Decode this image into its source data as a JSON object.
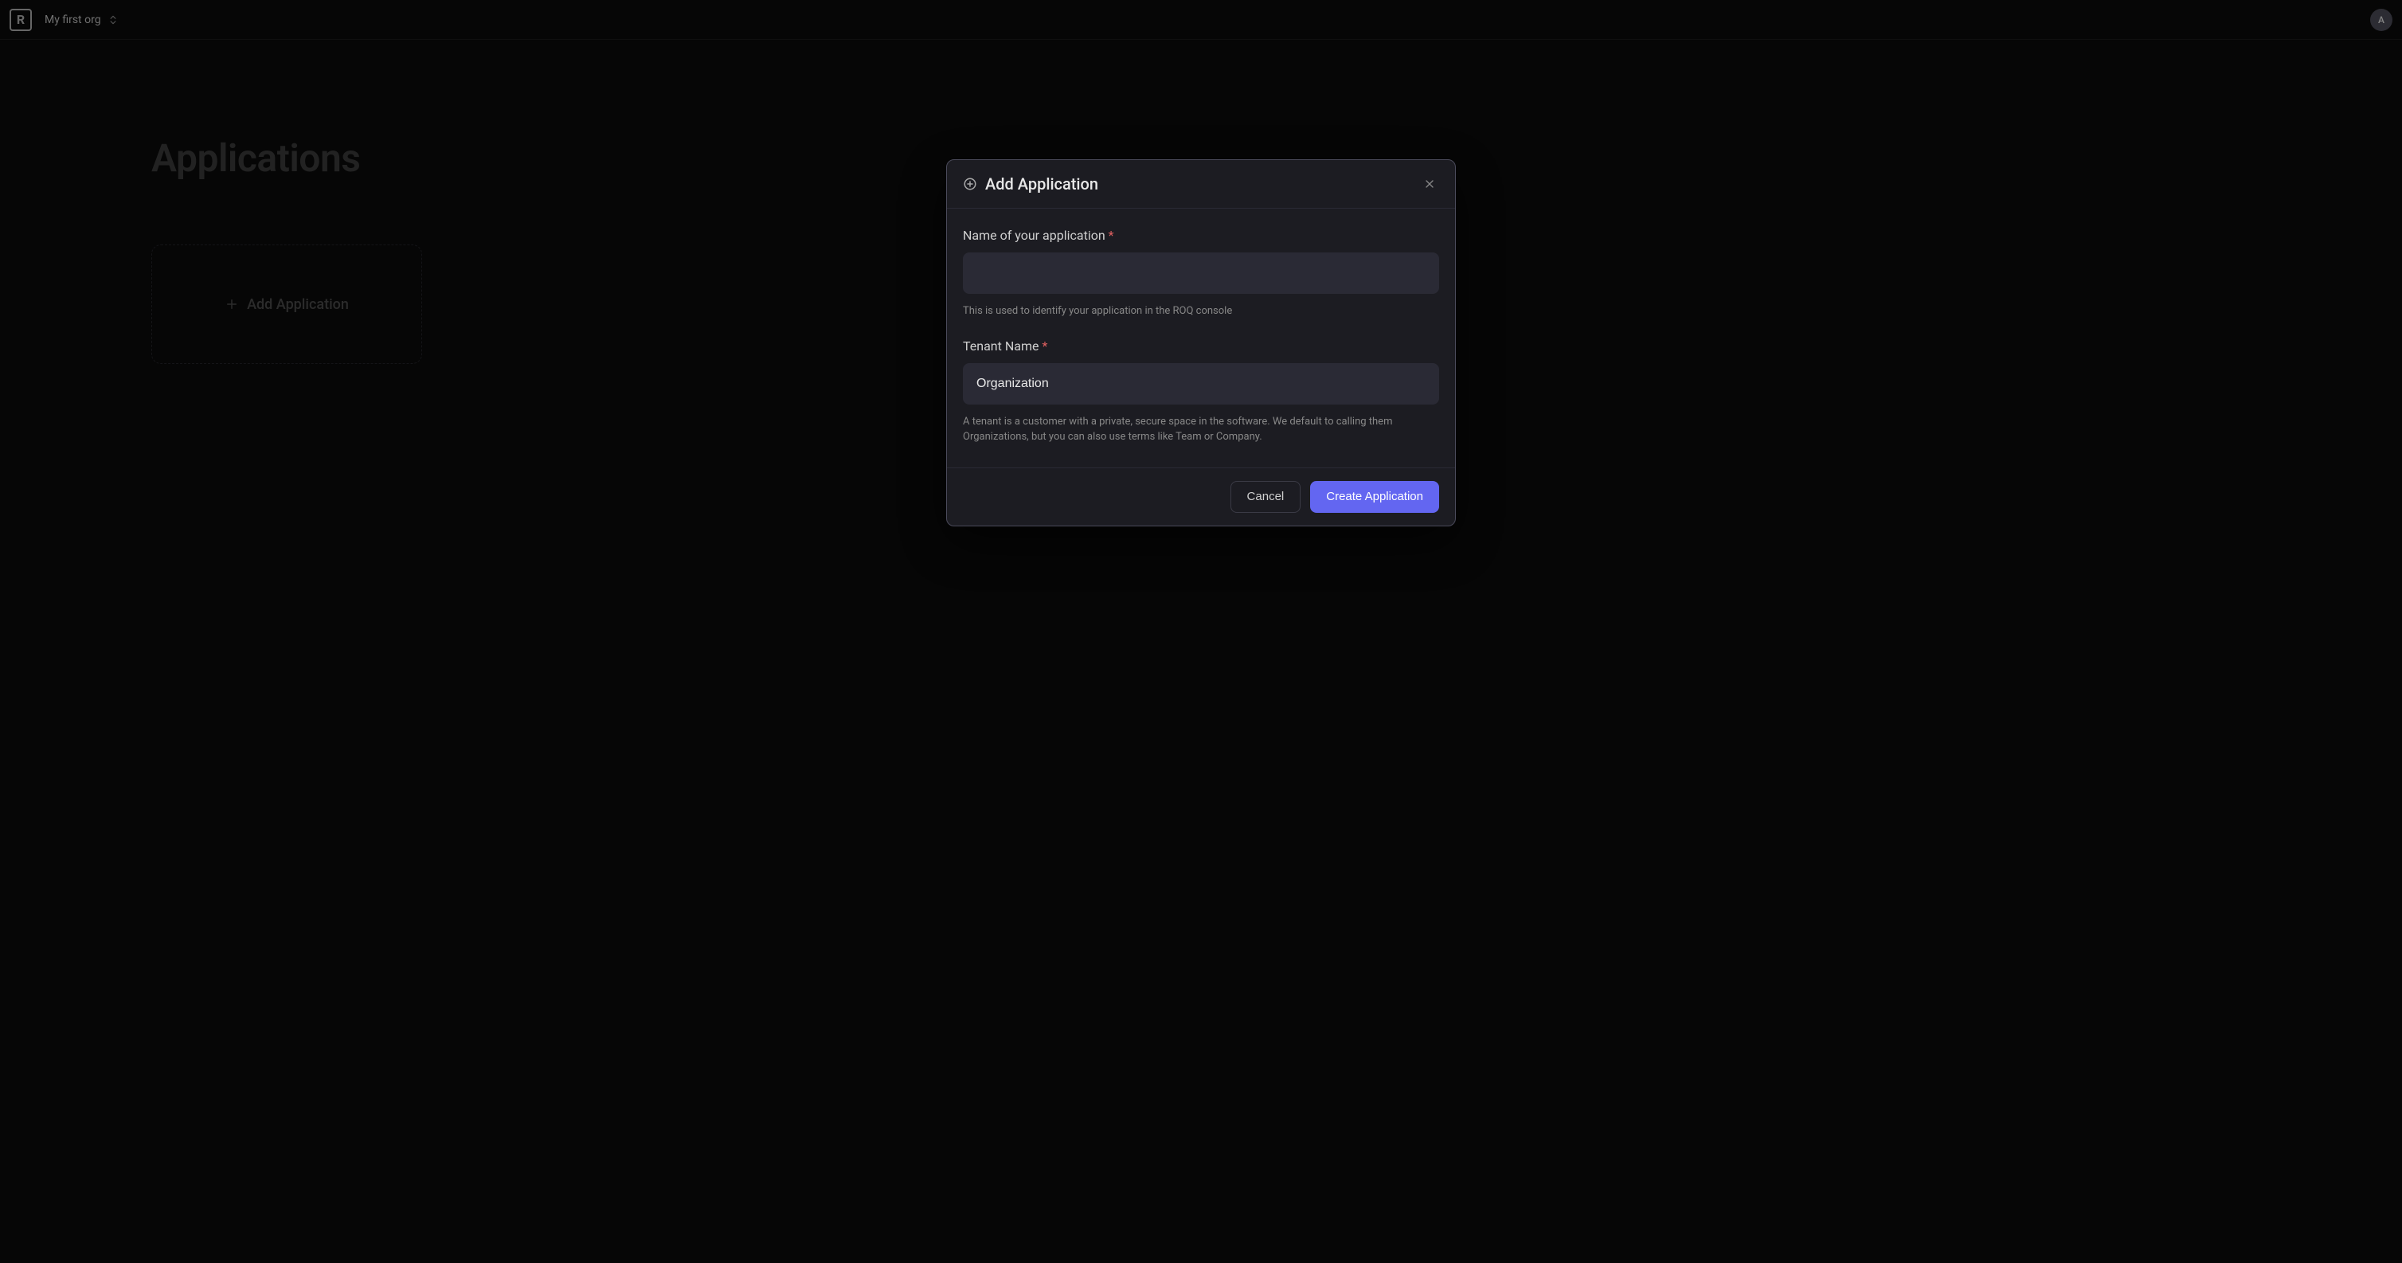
{
  "topbar": {
    "logo_letter": "R",
    "org_name": "My first org",
    "avatar_initial": "A"
  },
  "page": {
    "title": "Applications",
    "add_card_label": "Add Application"
  },
  "modal": {
    "title": "Add Application",
    "fields": {
      "app_name": {
        "label": "Name of your application",
        "required_mark": "*",
        "value": "",
        "help": "This is used to identify your application in the ROQ console"
      },
      "tenant_name": {
        "label": "Tenant Name",
        "required_mark": "*",
        "value": "Organization",
        "help": "A tenant is a customer with a private, secure space in the software. We default to calling them Organizations, but you can also use terms like Team or Company."
      }
    },
    "buttons": {
      "cancel": "Cancel",
      "create": "Create Application"
    }
  }
}
